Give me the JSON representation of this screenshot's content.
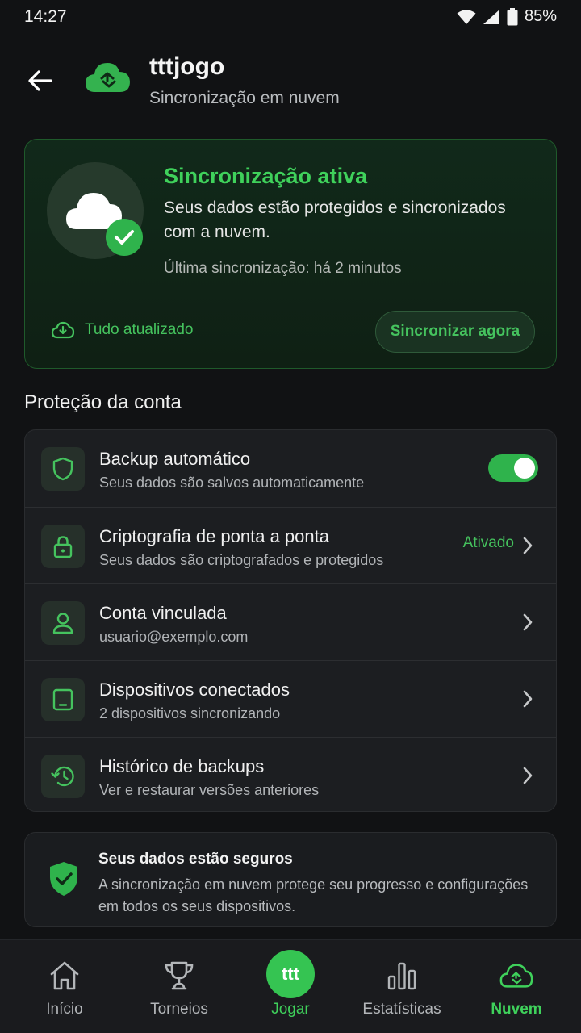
{
  "status_bar": {
    "time": "14:27",
    "battery": "85%"
  },
  "header": {
    "title": "tttjogo",
    "subtitle": "Sincronização em nuvem"
  },
  "sync_card": {
    "title": "Sincronização ativa",
    "description": "Seus dados estão protegidos e sincronizados com a nuvem.",
    "last_sync": "Última sincronização: há 2 minutos",
    "status": "Tudo atualizado",
    "sync_now_label": "Sincronizar agora"
  },
  "section": {
    "title": "Proteção da conta"
  },
  "settings": {
    "items": [
      {
        "title": "Backup automático",
        "subtitle": "Seus dados são salvos automaticamente",
        "toggle_on": true
      },
      {
        "title": "Criptografia de ponta a ponta",
        "subtitle": "Seus dados são criptografados e protegidos",
        "value": "Ativado"
      },
      {
        "title": "Conta vinculada",
        "subtitle": "usuario@exemplo.com"
      },
      {
        "title": "Dispositivos conectados",
        "subtitle": "2 dispositivos sincronizando"
      },
      {
        "title": "Histórico de backups",
        "subtitle": "Ver e restaurar versões anteriores"
      }
    ]
  },
  "secure_notice": {
    "title": "Seus dados estão seguros",
    "description": "A sincronização em nuvem protege seu progresso e configurações em todos os seus dispositivos."
  },
  "bottom_nav": {
    "items": [
      {
        "label": "Início",
        "icon": "home-icon"
      },
      {
        "label": "Torneios",
        "icon": "trophy-icon"
      },
      {
        "label": "Jogar",
        "icon": "play-badge",
        "badge": "ttt"
      },
      {
        "label": "Estatísticas",
        "icon": "bar-chart-icon"
      },
      {
        "label": "Nuvem",
        "icon": "cloud-sync-icon",
        "active": true
      }
    ]
  },
  "colors": {
    "accent": "#3fd15b",
    "background": "#111214",
    "card": "#1c1e21"
  }
}
